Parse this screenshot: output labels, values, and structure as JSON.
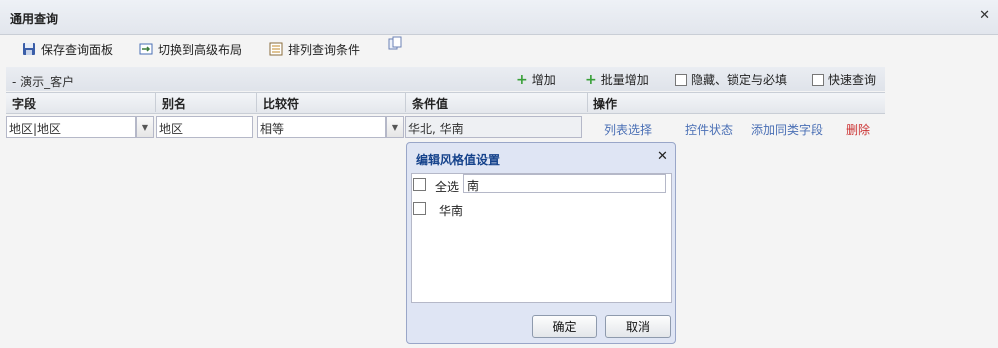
{
  "window": {
    "title": "通用查询"
  },
  "toolbar": {
    "save_label": "保存查询面板",
    "switch_label": "切换到高级布局",
    "sort_label": "排列查询条件"
  },
  "panel": {
    "title": "- 演示_客户",
    "actions": {
      "add": "增加",
      "batch_add": "批量增加",
      "hide_lock": "隐藏、锁定与必填",
      "quick": "快速查询"
    }
  },
  "table": {
    "headers": [
      "字段",
      "别名",
      "比较符",
      "条件值",
      "操作"
    ],
    "row": {
      "field": "地区|地区",
      "alias": "地区",
      "operator": "相等",
      "value": "华北, 华南",
      "actions": [
        "列表选择",
        "控件状态",
        "添加同类字段",
        "删除"
      ]
    }
  },
  "dialog": {
    "title": "编辑风格值设置",
    "select_all_label": "全选",
    "filter_value": "南",
    "items": [
      "华南"
    ],
    "ok_label": "确定",
    "cancel_label": "取消"
  },
  "colors": {
    "link": "#4a6fb5",
    "delete": "#cc3333",
    "add_icon": "#39a039"
  }
}
